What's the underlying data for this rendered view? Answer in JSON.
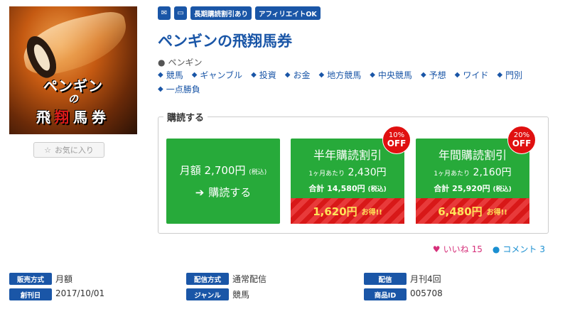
{
  "cover": {
    "line1": "ペンギン",
    "line2": "の",
    "line3_a": "飛",
    "line3_b": "翔",
    "line3_c": "馬券"
  },
  "favorite_label": "お気に入り",
  "badges": [
    "長期購読割引あり",
    "アフィリエイトOK"
  ],
  "title": "ペンギンの飛翔馬券",
  "author": "ペンギン",
  "tags": [
    "競馬",
    "ギャンブル",
    "投資",
    "お金",
    "地方競馬",
    "中央競馬",
    "予想",
    "ワイド",
    "門別",
    "一点勝負"
  ],
  "subscribe": {
    "legend": "購読する",
    "monthly": {
      "price": "月額 2,700円",
      "tax": "(税込)",
      "action": "購読する"
    },
    "half": {
      "name": "半年購読割引",
      "per_label": "1ヶ月あたり",
      "per_price": "2,430円",
      "total_label": "合計",
      "total_price": "14,580円",
      "tax": "(税込)",
      "save": "1,620円",
      "save_label": "お得!!",
      "off_pct": "10%",
      "off_word": "OFF"
    },
    "year": {
      "name": "年間購読割引",
      "per_label": "1ヶ月あたり",
      "per_price": "2,160円",
      "total_label": "合計",
      "total_price": "25,920円",
      "tax": "(税込)",
      "save": "6,480円",
      "save_label": "お得!!",
      "off_pct": "20%",
      "off_word": "OFF"
    }
  },
  "reactions": {
    "like_label": "いいね",
    "like_count": "15",
    "comment_label": "コメント",
    "comment_count": "3"
  },
  "info": {
    "sales_method_label": "販売方式",
    "sales_method": "月額",
    "delivery_method_label": "配信方式",
    "delivery_method": "通常配信",
    "delivery_label": "配信",
    "delivery": "月刊4回",
    "launch_label": "創刊日",
    "launch": "2017/10/01",
    "genre_label": "ジャンル",
    "genre": "競馬",
    "product_id_label": "商品ID",
    "product_id": "005708"
  },
  "colors": {
    "brand": "#1a56a7",
    "green": "#27aa3a",
    "red": "#e01010",
    "like": "#d6307a",
    "comment": "#1a8fd1"
  }
}
